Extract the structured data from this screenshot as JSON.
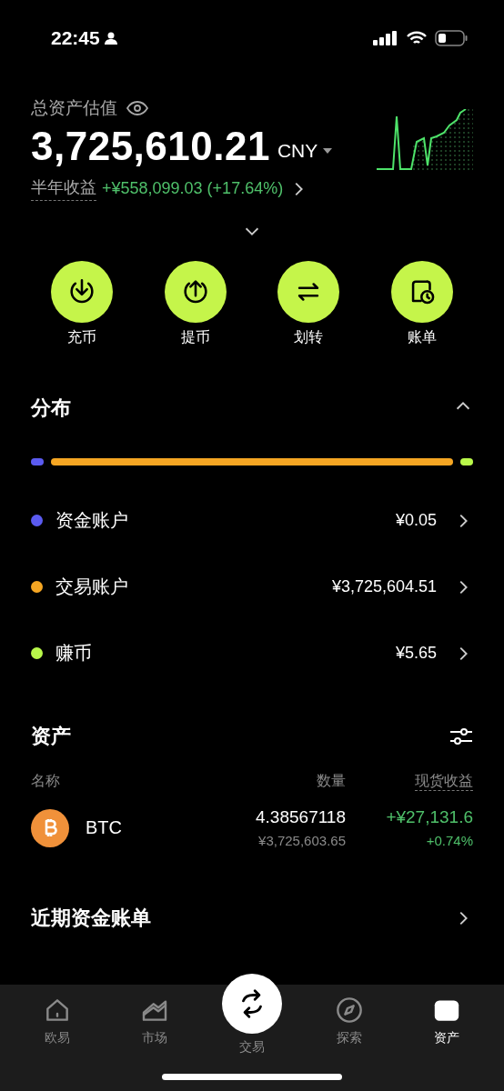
{
  "status_bar": {
    "time": "22:45"
  },
  "summary": {
    "title": "总资产估值",
    "total": "3,725,610.21",
    "currency": "CNY",
    "earnings_label": "半年收益",
    "earnings": "+¥558,099.03 (+17.64%)"
  },
  "actions": [
    {
      "kind": "deposit",
      "label": "充币"
    },
    {
      "kind": "withdraw",
      "label": "提币"
    },
    {
      "kind": "transfer",
      "label": "划转"
    },
    {
      "kind": "bill",
      "label": "账单"
    }
  ],
  "distribution": {
    "title": "分布",
    "expanded": true,
    "accounts": [
      {
        "name": "资金账户",
        "value": "¥0.05",
        "color": "#5b5bf0"
      },
      {
        "name": "交易账户",
        "value": "¥3,725,604.51",
        "color": "#f5a623"
      },
      {
        "name": "赚币",
        "value": "¥5.65",
        "color": "#b9f84a"
      }
    ]
  },
  "assets": {
    "title": "资产",
    "columns": [
      "名称",
      "数量",
      "现货收益"
    ],
    "rows": [
      {
        "symbol": "BTC",
        "amount": "4.38567118",
        "value": "¥3,725,603.65",
        "pnl": "+¥27,131.6",
        "pnl_percent": "+0.74%"
      }
    ]
  },
  "recent_bills": {
    "title": "近期资金账单"
  },
  "tab_bar": [
    {
      "kind": "home",
      "label": "欧易",
      "selected": false
    },
    {
      "kind": "market",
      "label": "市场",
      "selected": false
    },
    {
      "kind": "trade",
      "label": "交易",
      "selected": false
    },
    {
      "kind": "explore",
      "label": "探索",
      "selected": false
    },
    {
      "kind": "assets",
      "label": "资产",
      "selected": true
    }
  ]
}
